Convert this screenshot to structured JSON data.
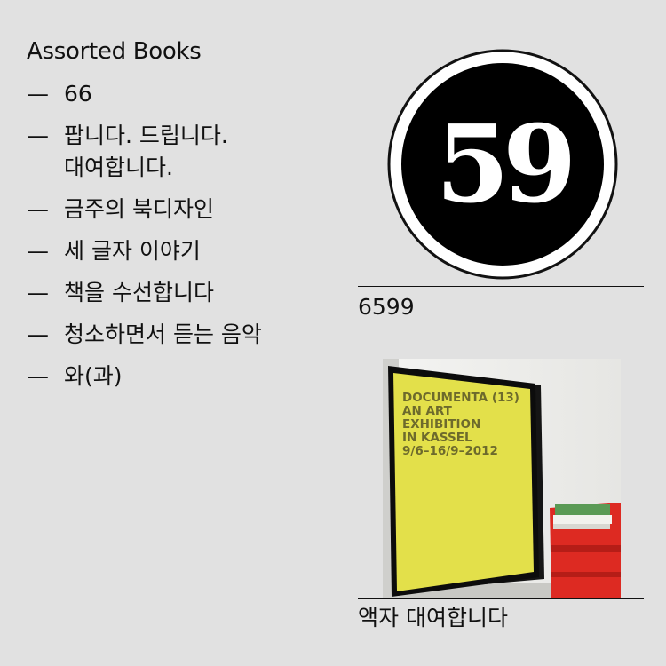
{
  "brand": "Assorted Books",
  "menu": {
    "dash": "—",
    "items": [
      {
        "label": "66"
      },
      {
        "label": "팝니다. 드립니다.\n대여합니다."
      },
      {
        "label": "금주의 북디자인"
      },
      {
        "label": "세 글자 이야기"
      },
      {
        "label": "책을 수선합니다"
      },
      {
        "label": "청소하면서 듣는 음악"
      },
      {
        "label": "와(과)"
      }
    ]
  },
  "feature1": {
    "logo_number": "59",
    "caption": "6599"
  },
  "feature2": {
    "poster_lines": [
      "DOCUMENTA (13)",
      "AN ART",
      "EXHIBITION",
      "IN KASSEL",
      "9/6–16/9–2012"
    ],
    "caption": "액자 대여합니다"
  },
  "colors": {
    "background": "#e1e1e1",
    "text": "#111111",
    "poster_yellow": "#e3e04a",
    "poster_text": "#6d6a2c",
    "shelf_red": "#dd2a22"
  }
}
